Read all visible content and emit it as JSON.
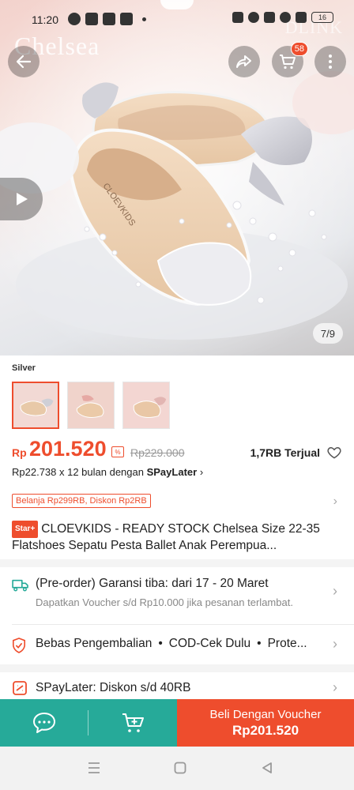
{
  "status_bar": {
    "time": "11:20",
    "battery": "16"
  },
  "hero": {
    "brand_watermark": "Chelsea",
    "brand_watermark_right": "DLINK",
    "cart_count": "58",
    "image_counter": "7/9"
  },
  "variant": {
    "label": "Silver",
    "thumbnails": [
      "thumb-1",
      "thumb-2",
      "thumb-3"
    ],
    "selected_index": 0
  },
  "price": {
    "currency": "Rp",
    "current": "201.520",
    "original": "Rp229.000",
    "sold": "1,7RB Terjual"
  },
  "installment": {
    "text": "Rp22.738 x 12 bulan dengan ",
    "provider": "SPayLater"
  },
  "promo": {
    "label": "Belanja Rp299RB, Diskon Rp2RB"
  },
  "product": {
    "badge": "Star+",
    "title": "CLOEVKIDS - READY STOCK Chelsea Size 22-35 Flatshoes Sepatu Pesta Ballet Anak Perempua..."
  },
  "shipping": {
    "main": "(Pre-order) Garansi tiba: dari 17 - 20 Maret",
    "sub": "Dapatkan Voucher s/d Rp10.000 jika pesanan terlambat."
  },
  "guarantee": {
    "items": [
      "Bebas Pengembalian",
      "COD-Cek Dulu",
      "Prote..."
    ]
  },
  "spaylater": {
    "text": "SPayLater: Diskon s/d 40RB"
  },
  "action_bar": {
    "buy_label": "Beli Dengan Voucher",
    "buy_price": "Rp201.520"
  },
  "colors": {
    "accent": "#ee4d2d",
    "teal": "#26aa99"
  },
  "icons": {
    "back": "arrow-left-icon",
    "share": "share-icon",
    "cart": "cart-icon",
    "more": "more-vertical-icon",
    "play": "play-icon",
    "heart": "heart-icon",
    "truck": "truck-icon",
    "shield": "shield-check-icon",
    "spaylater": "spaylater-icon",
    "chat": "chat-icon",
    "add_cart": "add-cart-icon"
  }
}
